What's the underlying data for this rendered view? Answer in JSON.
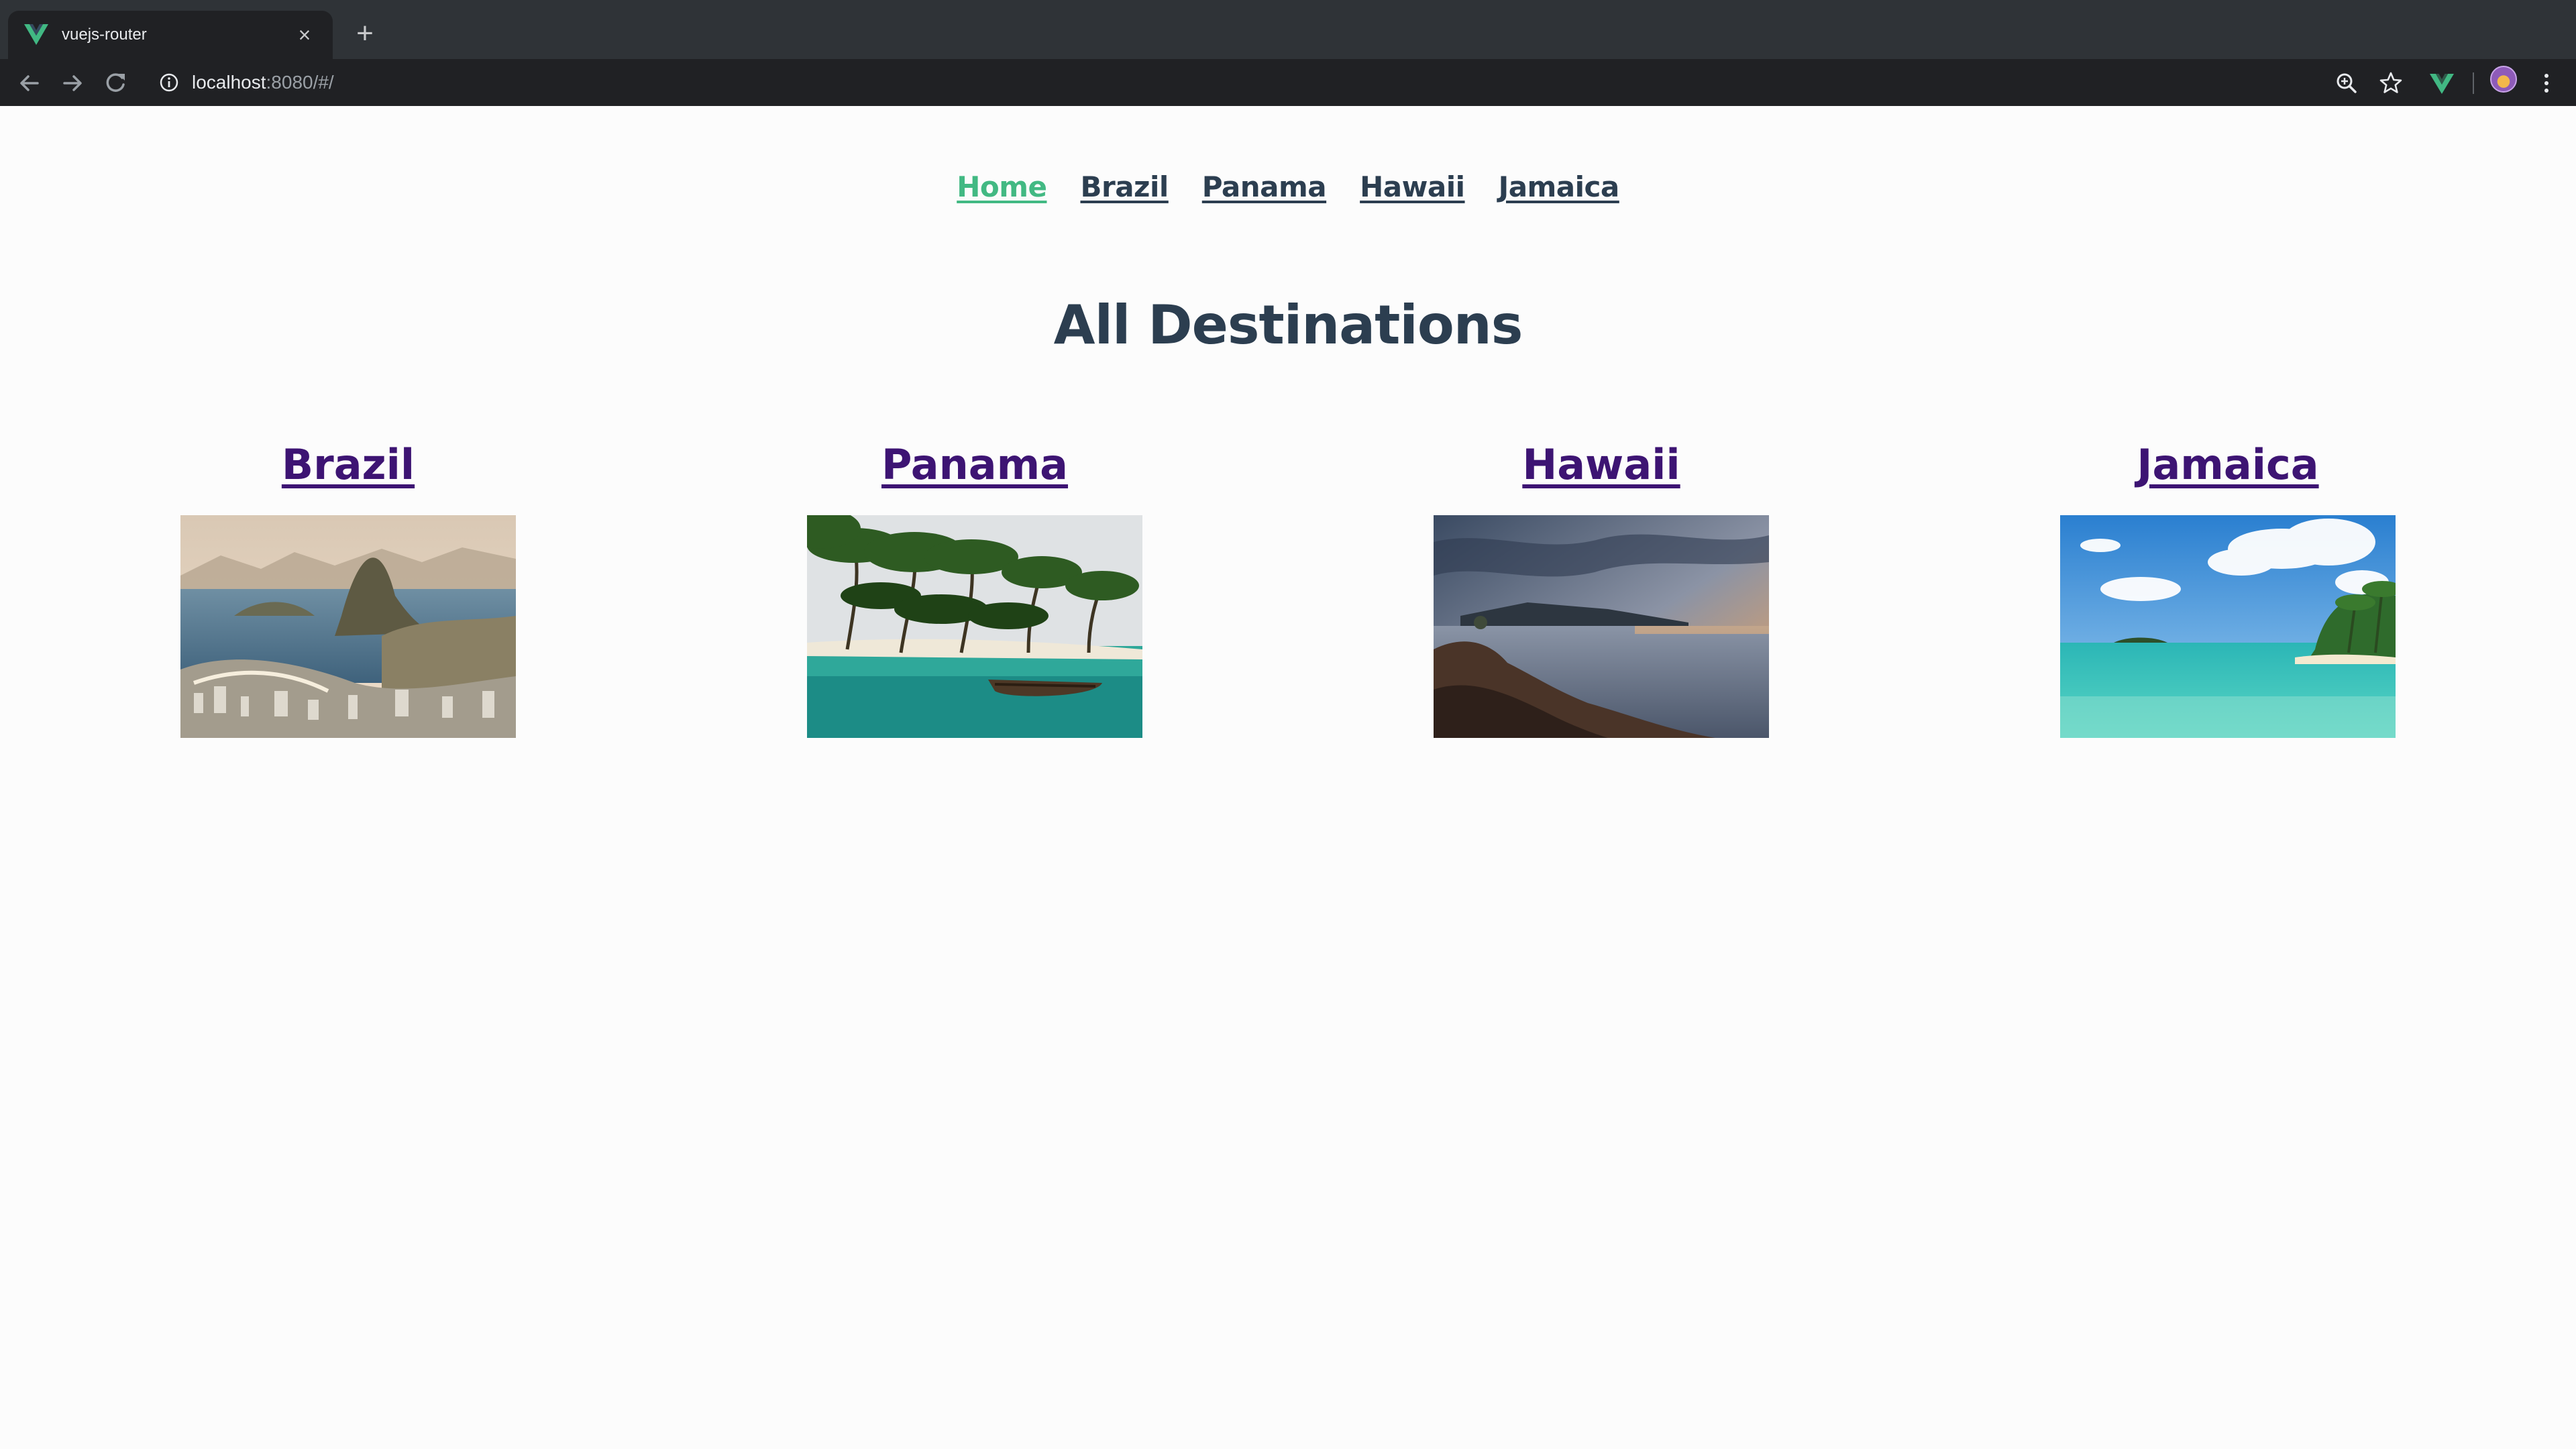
{
  "browser": {
    "tab_title": "vuejs-router",
    "new_tab_symbol": "+",
    "close_symbol": "×",
    "url_host": "localhost",
    "url_rest": ":8080/#/"
  },
  "nav": {
    "items": [
      {
        "label": "Home",
        "active": true
      },
      {
        "label": "Brazil",
        "active": false
      },
      {
        "label": "Panama",
        "active": false
      },
      {
        "label": "Hawaii",
        "active": false
      },
      {
        "label": "Jamaica",
        "active": false
      }
    ]
  },
  "page": {
    "heading": "All Destinations"
  },
  "destinations": [
    {
      "name": "Brazil",
      "image": "rio-de-janeiro-sugarloaf-photo"
    },
    {
      "name": "Panama",
      "image": "palm-beach-canoe-photo"
    },
    {
      "name": "Hawaii",
      "image": "rocky-coast-sunset-photo"
    },
    {
      "name": "Jamaica",
      "image": "turquoise-lagoon-photo"
    }
  ],
  "colors": {
    "nav_text": "#2c3e50",
    "nav_active": "#42b983",
    "dest_link": "#3d1473",
    "chrome_dark": "#202124",
    "tab_strip": "#2f3337"
  }
}
